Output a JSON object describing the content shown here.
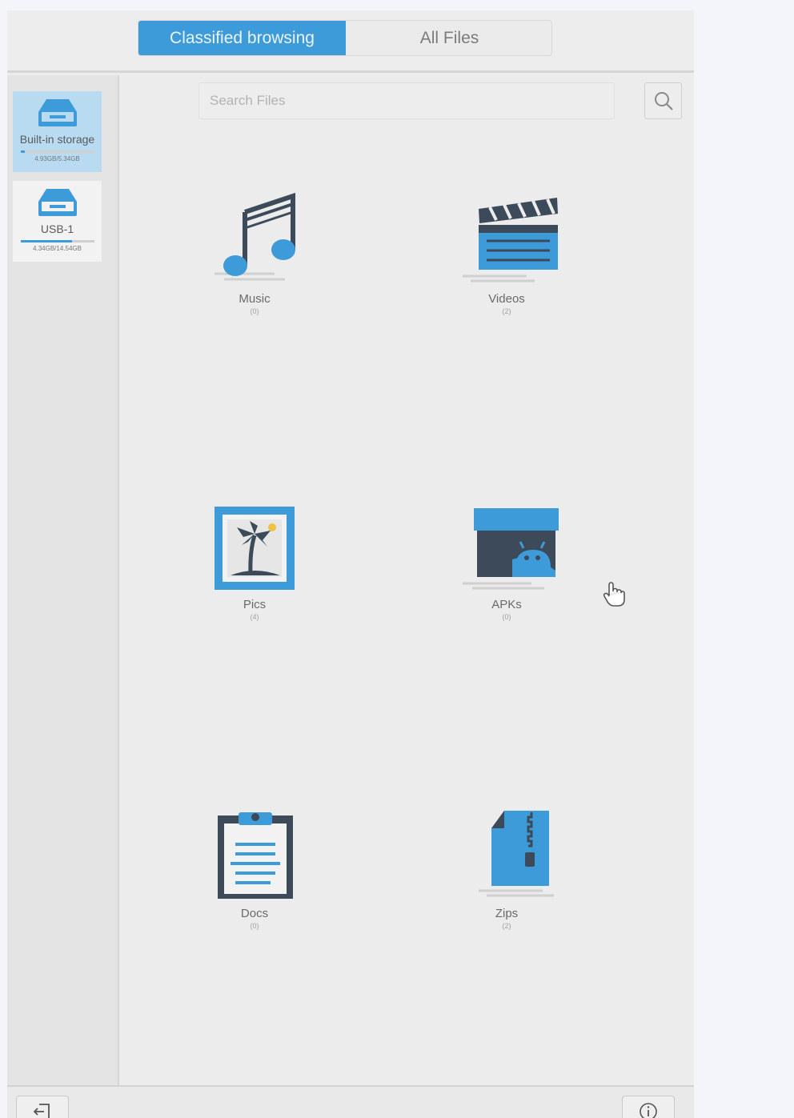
{
  "tabs": [
    {
      "label": "Classified browsing",
      "active": true
    },
    {
      "label": "All Files",
      "active": false
    }
  ],
  "sidebar": {
    "devices": [
      {
        "label": "Built-in storage",
        "size": "4.93GB/5.34GB",
        "used_fraction": 0.06,
        "selected": true,
        "icon": "drive-icon"
      },
      {
        "label": "USB-1",
        "size": "4.34GB/14.54GB",
        "used_fraction": 0.7,
        "selected": false,
        "icon": "usb-drive-icon"
      }
    ]
  },
  "search": {
    "placeholder": "Search Files",
    "value": ""
  },
  "categories": [
    {
      "label": "Music",
      "count": "(0)",
      "icon": "music-note-icon"
    },
    {
      "label": "Videos",
      "count": "(2)",
      "icon": "clapperboard-icon"
    },
    {
      "label": "Pics",
      "count": "(4)",
      "icon": "picture-icon"
    },
    {
      "label": "APKs",
      "count": "(0)",
      "icon": "android-box-icon"
    },
    {
      "label": "Docs",
      "count": "(0)",
      "icon": "clipboard-icon"
    },
    {
      "label": "Zips",
      "count": "(2)",
      "icon": "zip-file-icon"
    }
  ],
  "bottom": {
    "left_icon": "exit-icon",
    "right_icon": "info-icon"
  },
  "colors": {
    "accent": "#3e9bd9",
    "dark": "#3c4a59",
    "background": "#ececec"
  }
}
